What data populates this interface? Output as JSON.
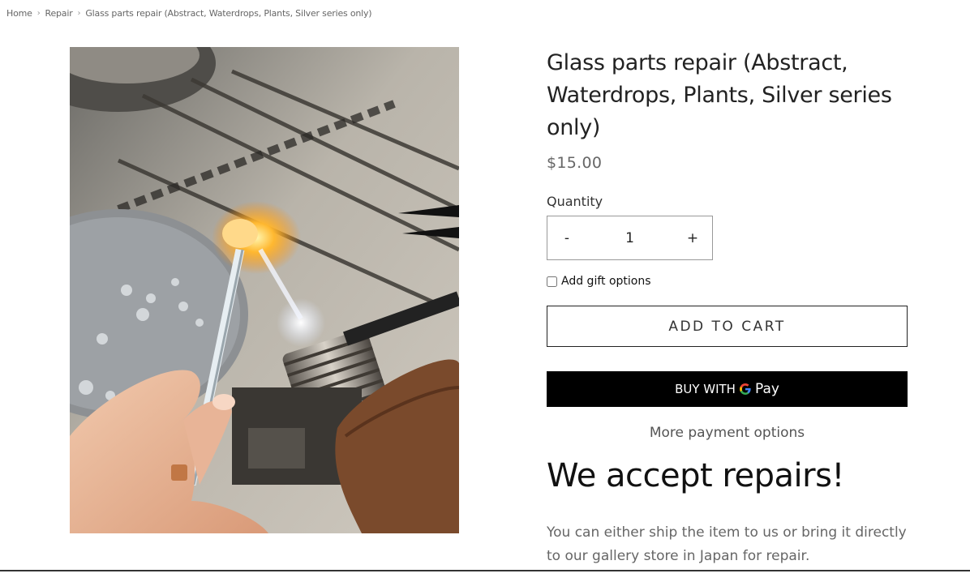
{
  "breadcrumb": {
    "home": "Home",
    "sep1": "›",
    "repair": "Repair",
    "sep2": "›",
    "current": "Glass parts repair (Abstract, Waterdrops, Plants, Silver series only)"
  },
  "product": {
    "title": "Glass parts repair (Abstract, Waterdrops, Plants, Silver series only)",
    "price": "$15.00",
    "quantity_label": "Quantity",
    "quantity_value": "1",
    "minus": "-",
    "plus": "+",
    "gift_label": "Add gift options",
    "add_to_cart": "ADD TO CART",
    "buy_with": "BUY WITH",
    "pay": "Pay",
    "more_payment": "More payment options"
  },
  "repairs": {
    "heading": "We accept repairs!",
    "text": "You can either ship the item to us or bring it directly to our gallery store in Japan for repair."
  },
  "colors": {
    "accent": "#000000",
    "text": "#222222",
    "muted": "#666666"
  },
  "icons": {
    "gpay": "google-g-icon"
  }
}
